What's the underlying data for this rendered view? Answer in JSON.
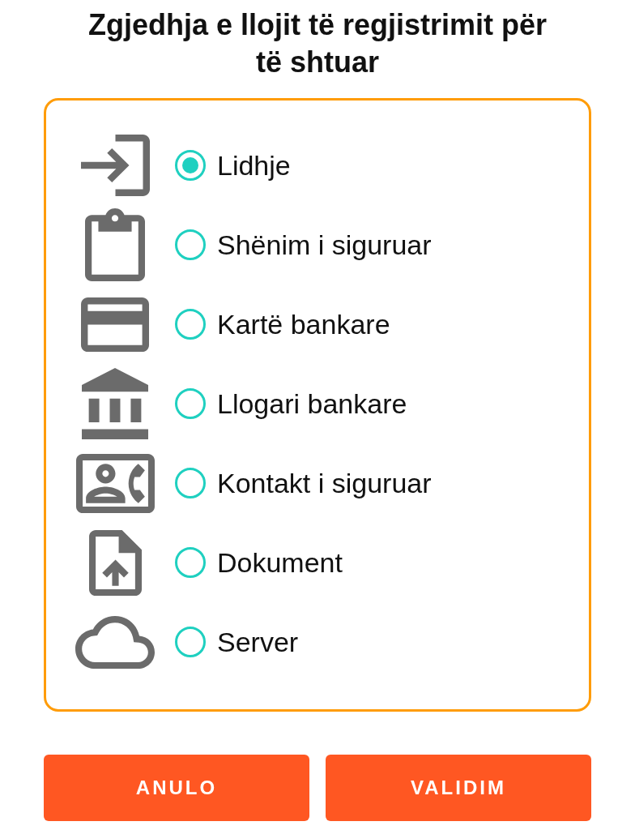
{
  "title": "Zgjedhja e llojit të regjistrimit për të shtuar",
  "options": [
    {
      "kind": "login",
      "label": "Lidhje",
      "selected": true
    },
    {
      "kind": "note",
      "label": "Shënim i siguruar",
      "selected": false
    },
    {
      "kind": "card",
      "label": "Kartë bankare",
      "selected": false
    },
    {
      "kind": "bank",
      "label": "Llogari bankare",
      "selected": false
    },
    {
      "kind": "contact",
      "label": "Kontakt i siguruar",
      "selected": false
    },
    {
      "kind": "document",
      "label": "Dokument",
      "selected": false
    },
    {
      "kind": "server",
      "label": "Server",
      "selected": false
    }
  ],
  "buttons": [
    {
      "label": "ANULO"
    },
    {
      "label": "VALIDIM"
    }
  ]
}
